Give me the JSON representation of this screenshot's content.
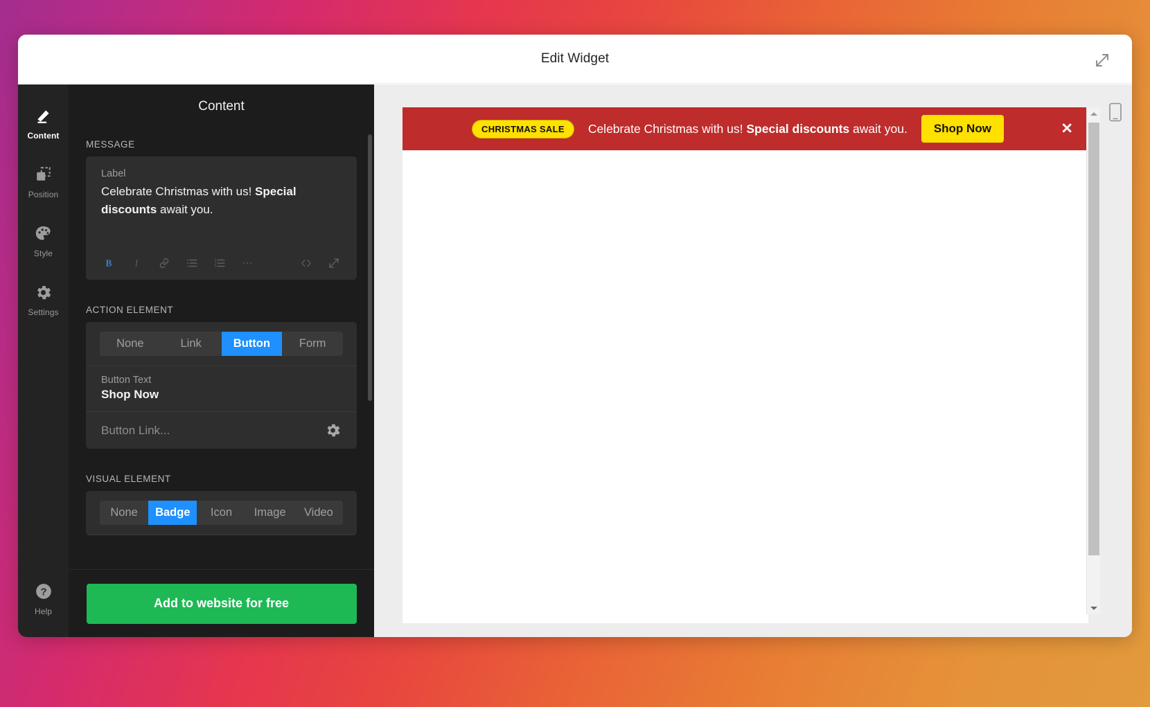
{
  "window": {
    "title": "Edit Widget",
    "expand_icon": "expand-diagonal-icon"
  },
  "sidebar": {
    "items": [
      {
        "label": "Content",
        "icon": "pencil-icon",
        "active": true
      },
      {
        "label": "Position",
        "icon": "position-icon",
        "active": false
      },
      {
        "label": "Style",
        "icon": "palette-icon",
        "active": false
      },
      {
        "label": "Settings",
        "icon": "gear-icon",
        "active": false
      }
    ],
    "help": {
      "label": "Help",
      "icon": "question-circle-icon"
    }
  },
  "panel": {
    "title": "Content",
    "message": {
      "section_label": "MESSAGE",
      "field_label": "Label",
      "text_plain": "Celebrate Christmas with us! Special discounts await you.",
      "text_before_bold": "Celebrate Christmas with us! ",
      "text_bold": "Special discounts",
      "text_after_bold": " await you.",
      "toolbar": [
        {
          "name": "bold-button",
          "glyph": "B",
          "active": true
        },
        {
          "name": "italic-button",
          "glyph": "I",
          "active": false
        },
        {
          "name": "link-button",
          "glyph": "🔗",
          "active": false
        },
        {
          "name": "bullet-list-button",
          "glyph": "☰",
          "active": false
        },
        {
          "name": "numbered-list-button",
          "glyph": "☰",
          "active": false
        },
        {
          "name": "more-options-button",
          "glyph": "•••",
          "active": false
        },
        {
          "name": "code-view-button",
          "glyph": "< >",
          "active": false
        },
        {
          "name": "expand-editor-button",
          "glyph": "⤡",
          "active": false
        }
      ]
    },
    "action_element": {
      "section_label": "ACTION ELEMENT",
      "options": [
        "None",
        "Link",
        "Button",
        "Form"
      ],
      "selected": "Button",
      "button_text_label": "Button Text",
      "button_text_value": "Shop Now",
      "button_link_placeholder": "Button Link...",
      "button_link_value": "",
      "link_settings_icon": "gear-icon"
    },
    "visual_element": {
      "section_label": "VISUAL ELEMENT",
      "options": [
        "None",
        "Badge",
        "Icon",
        "Image",
        "Video"
      ],
      "selected": "Badge"
    },
    "cta_label": "Add to website for free"
  },
  "preview": {
    "device_icon": "mobile-device-icon",
    "banner": {
      "badge_text": "CHRISTMAS SALE",
      "message_before_bold": "Celebrate Christmas with us! ",
      "message_bold": "Special discounts",
      "message_after_bold": " await you.",
      "cta_label": "Shop Now",
      "close_icon": "close-icon",
      "close_glyph": "✕"
    },
    "scrollbar": {
      "up_icon": "scroll-up-arrow-icon",
      "down_icon": "scroll-down-arrow-icon"
    }
  },
  "colors": {
    "accent_blue": "#1e90ff",
    "cta_green": "#1eb955",
    "banner_red": "#be2c2c",
    "badge_yellow": "#ffe100",
    "panel_dark": "#1c1c1c",
    "rail_dark": "#232323"
  }
}
